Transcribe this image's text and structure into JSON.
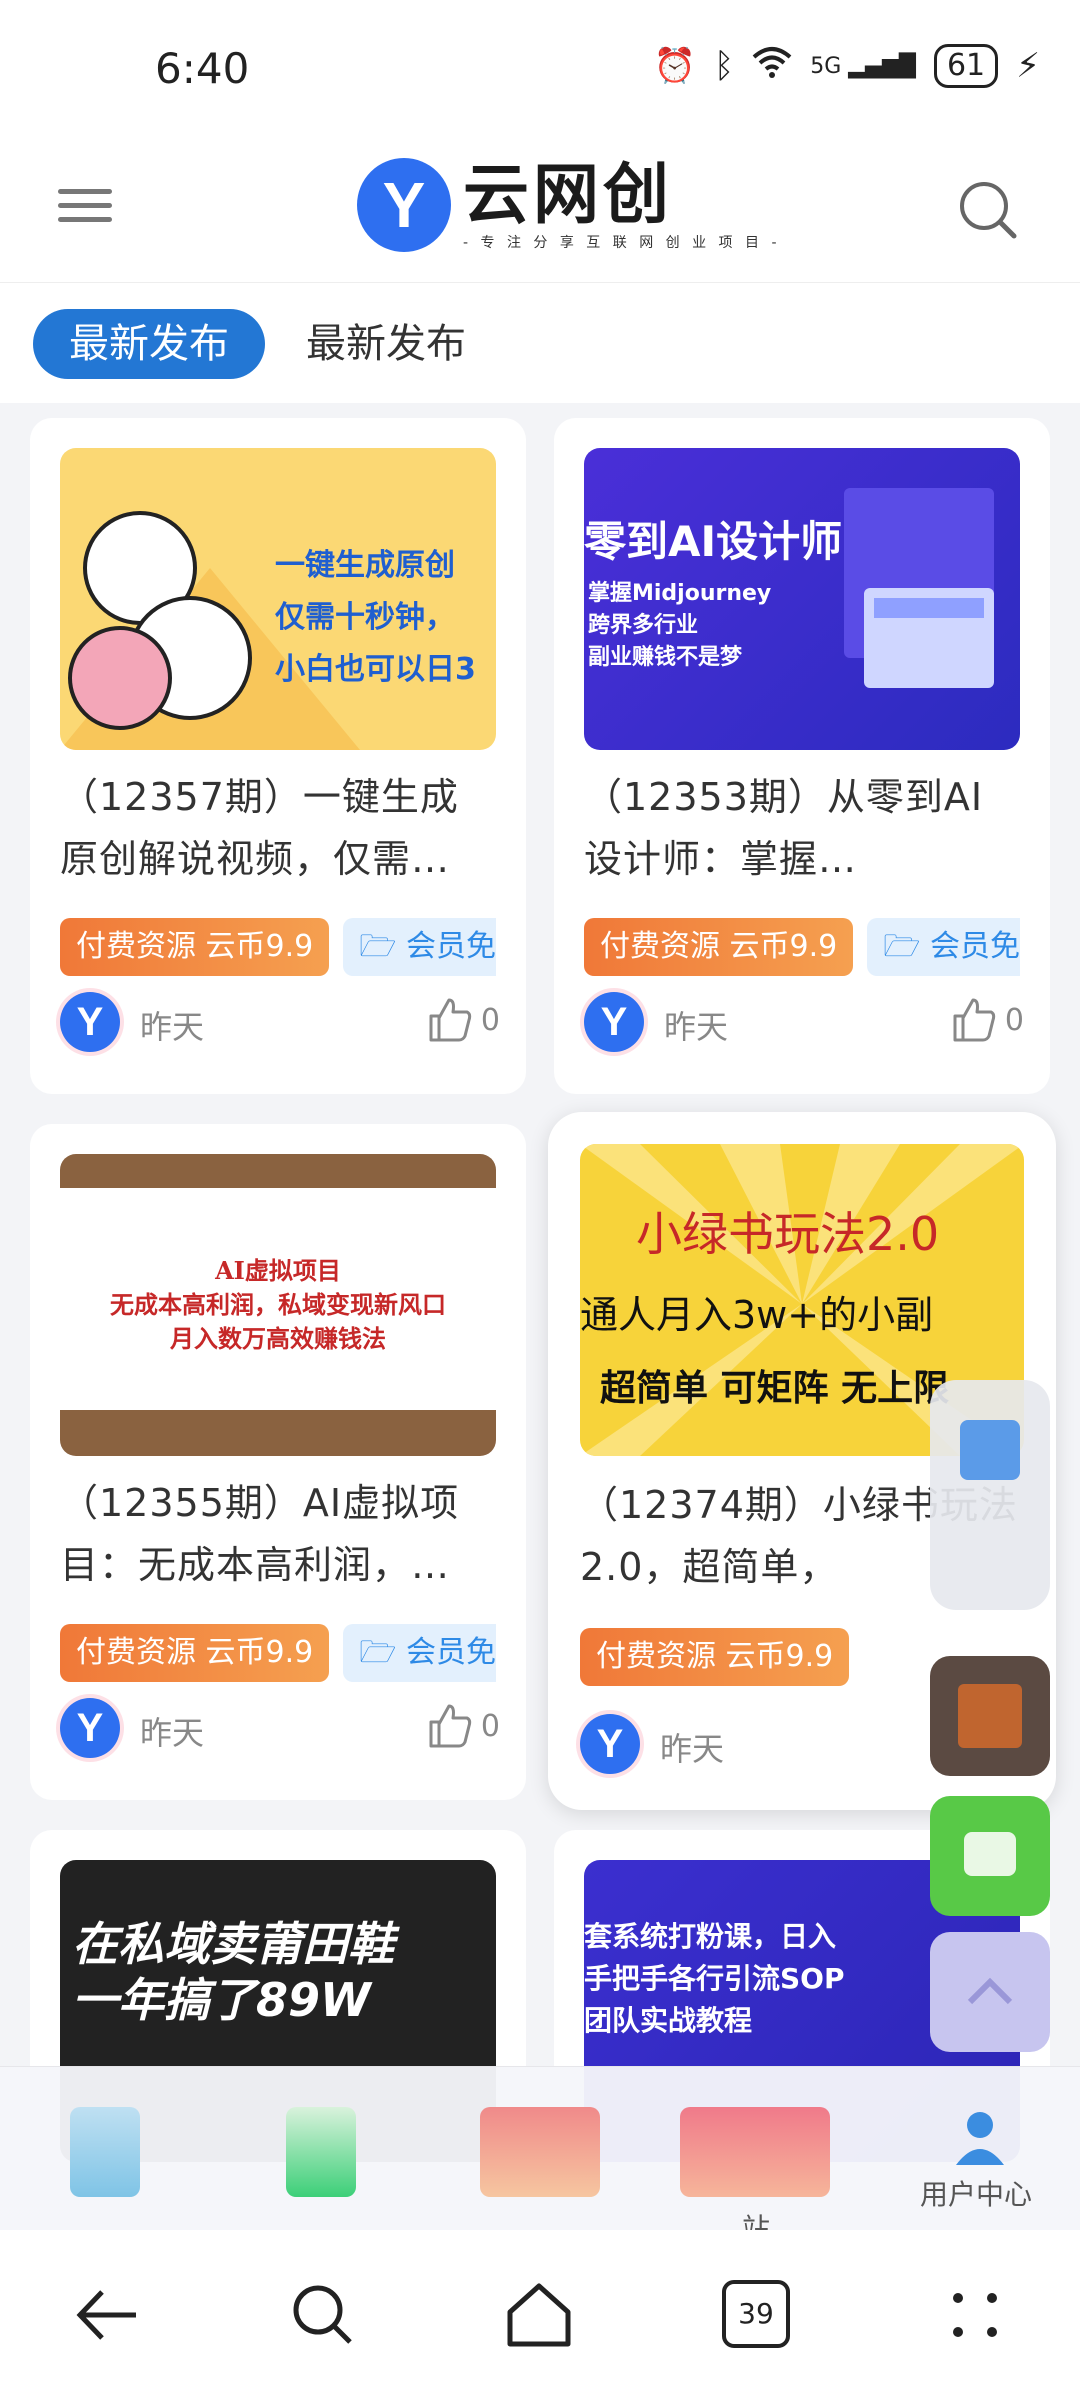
{
  "status": {
    "time": "6:40",
    "battery": "61",
    "network": "5G"
  },
  "header": {
    "logo_mark": "Y",
    "logo_title": "云网创",
    "logo_slogan": "- 专 注 分 享 互 联 网 创 业 项 目 -"
  },
  "tabs": [
    {
      "label": "最新发布"
    },
    {
      "label": "最新发布"
    }
  ],
  "cards": [
    {
      "title": "（12357期）一键生成原创解说视频，仅需…",
      "paid": "付费资源 云币9.9",
      "member": "会员免",
      "avatar": "Y",
      "date": "昨天",
      "likes": "0",
      "thumb_text": "一键生成原创\n仅需十秒钟，\n小白也可以日3"
    },
    {
      "title": "（12353期）从零到AI设计师：掌握…",
      "paid": "付费资源 云币9.9",
      "member": "会员免",
      "avatar": "Y",
      "date": "昨天",
      "likes": "0",
      "thumb_title": "零到AI设计师",
      "thumb_text": "掌握Midjourney\n跨界多行业\n副业赚钱不是梦"
    },
    {
      "title": "（12355期）AI虚拟项目：无成本高利润，…",
      "paid": "付费资源 云币9.9",
      "member": "会员免",
      "avatar": "Y",
      "date": "昨天",
      "likes": "0",
      "thumb_text": "AI虚拟项目\n无成本高利润，私域变现新风口\n月入数万高效赚钱法"
    },
    {
      "title": "（12374期）小绿书玩法2.0，超简单，",
      "paid": "付费资源 云币9.9",
      "avatar": "Y",
      "date": "昨天",
      "thumb_title": "小绿书玩法2.0",
      "thumb_text": "通人月入3w+的小副",
      "thumb_sub": "超简单 可矩阵 无上限"
    },
    {
      "thumb_text": "在私域卖莆田鞋\n一年搞了89W"
    },
    {
      "thumb_text": "套系统打粉课，日入\n手把手各行引流SOP\n团队实战教程"
    }
  ],
  "bottom_nav": [
    {
      "label": ""
    },
    {
      "label": ""
    },
    {
      "label": ""
    },
    {
      "label": "站"
    },
    {
      "label": "用户中心"
    }
  ],
  "sys_nav": {
    "tab_count": "39"
  },
  "colors": {
    "brand": "#2377d4",
    "paid_tag": "#f07838",
    "member_tag": "#2e8ae6"
  }
}
